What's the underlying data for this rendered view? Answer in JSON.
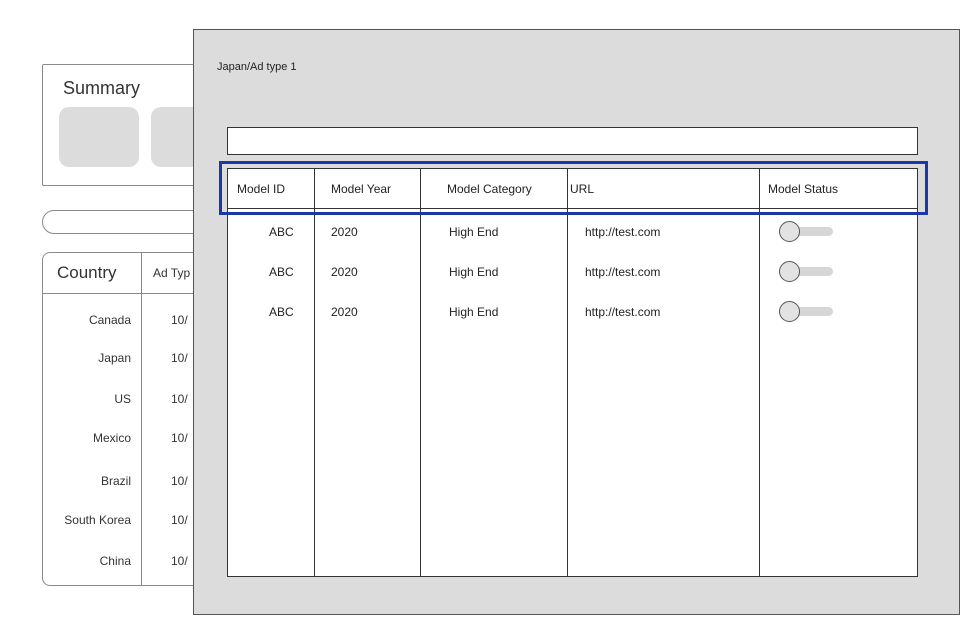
{
  "background": {
    "summary": {
      "title": "Summary"
    },
    "country_table": {
      "headers": {
        "country": "Country",
        "ad_type": "Ad Typ"
      },
      "rows": [
        {
          "country": "Canada",
          "value": "10/"
        },
        {
          "country": "Japan",
          "value": "10/"
        },
        {
          "country": "US",
          "value": "10/"
        },
        {
          "country": "Mexico",
          "value": "10/"
        },
        {
          "country": "Brazil",
          "value": "10/"
        },
        {
          "country": "South Korea",
          "value": "10/"
        },
        {
          "country": "China",
          "value": "10/"
        }
      ]
    }
  },
  "modal": {
    "breadcrumb": "Japan/Ad type 1",
    "search": {
      "value": "",
      "placeholder": ""
    },
    "table": {
      "headers": [
        "Model ID",
        "Model Year",
        "Model Category",
        "URL",
        "Model Status"
      ],
      "rows": [
        {
          "model_id": "ABC",
          "model_year": "2020",
          "model_category": "High End",
          "url": "http://test.com",
          "status_on": false
        },
        {
          "model_id": "ABC",
          "model_year": "2020",
          "model_category": "High End",
          "url": "http://test.com",
          "status_on": false
        },
        {
          "model_id": "ABC",
          "model_year": "2020",
          "model_category": "High End",
          "url": "http://test.com",
          "status_on": false
        }
      ]
    },
    "highlight_color": "#1c37a8"
  }
}
